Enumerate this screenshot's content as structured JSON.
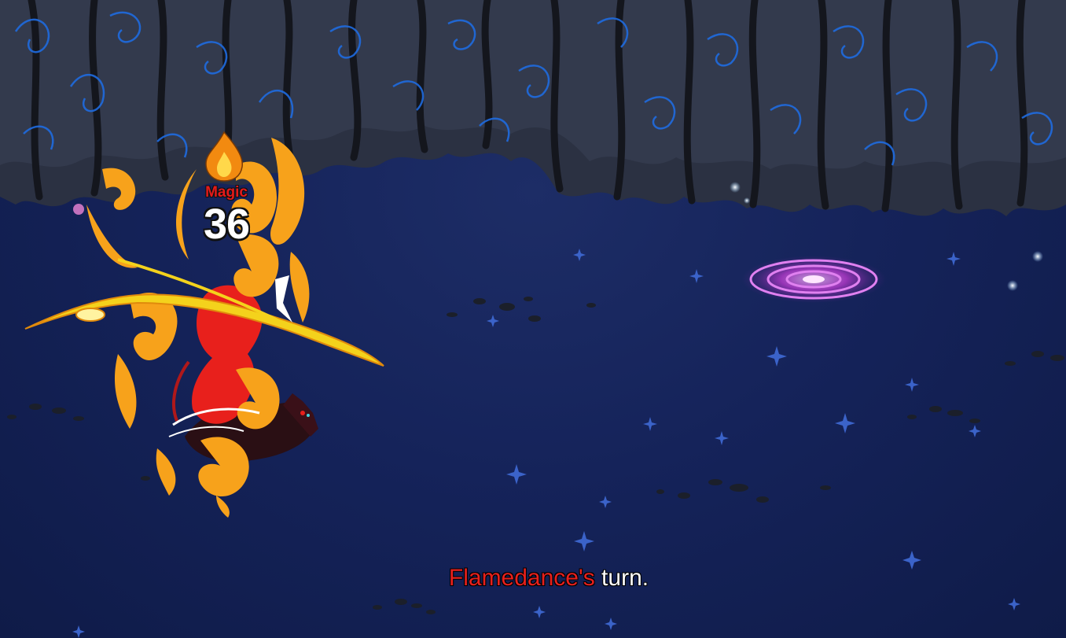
{
  "battle": {
    "damage_popup": {
      "element_icon": "fire-icon",
      "element_label": "Magic",
      "damage_value": "36"
    },
    "turn_message": {
      "name": "Flamedance's",
      "text": " turn."
    }
  },
  "colors": {
    "background": "#15235a",
    "cave_rock": "#2b3142",
    "vine_glow": "#1f6be0",
    "flame_orange": "#f7a21b",
    "flame_red": "#e8201c",
    "portal_magenta": "#c43bd6",
    "turn_name": "#e8201c"
  }
}
